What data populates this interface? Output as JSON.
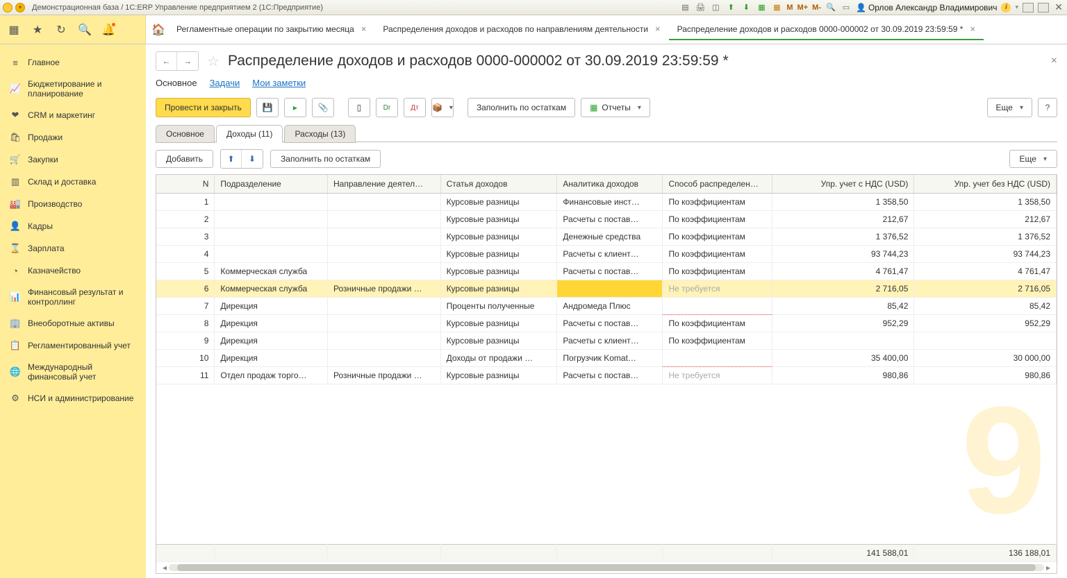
{
  "titlebar": {
    "text": "Демонстрационная база / 1С:ERP Управление предприятием 2  (1С:Предприятие)",
    "user": "Орлов Александр Владимирович",
    "m_labels": [
      "M",
      "M+",
      "M-"
    ]
  },
  "tabs": [
    {
      "label": "Регламентные операции по закрытию месяца",
      "active": false
    },
    {
      "label": "Распределения доходов и расходов по направлениям деятельности",
      "active": false
    },
    {
      "label": "Распределение доходов и расходов  0000-000002 от 30.09.2019 23:59:59 *",
      "active": true
    }
  ],
  "sidebar": [
    {
      "icon": "≡",
      "label": "Главное"
    },
    {
      "icon": "📈",
      "label": "Бюджетирование и планирование"
    },
    {
      "icon": "❤",
      "label": "CRM и маркетинг"
    },
    {
      "icon": "🛍",
      "label": "Продажи"
    },
    {
      "icon": "🛒",
      "label": "Закупки"
    },
    {
      "icon": "▥",
      "label": "Склад и доставка"
    },
    {
      "icon": "🏭",
      "label": "Производство"
    },
    {
      "icon": "👤",
      "label": "Кадры"
    },
    {
      "icon": "⌛",
      "label": "Зарплата"
    },
    {
      "icon": "◔",
      "label": "Казначейство"
    },
    {
      "icon": "📊",
      "label": "Финансовый результат и контроллинг"
    },
    {
      "icon": "🏢",
      "label": "Внеоборотные активы"
    },
    {
      "icon": "📋",
      "label": "Регламентированный учет"
    },
    {
      "icon": "🌐",
      "label": "Международный финансовый учет"
    },
    {
      "icon": "⚙",
      "label": "НСИ и администрирование"
    }
  ],
  "page": {
    "title": "Распределение доходов и расходов  0000-000002 от 30.09.2019 23:59:59 *",
    "subnav": {
      "main": "Основное",
      "tasks": "Задачи",
      "notes": "Мои заметки"
    },
    "buttons": {
      "post_close": "Провести и закрыть",
      "fill_balances": "Заполнить по остаткам",
      "reports": "Отчеты",
      "more": "Еще"
    },
    "section_tabs": {
      "main": "Основное",
      "income": "Доходы (11)",
      "expense": "Расходы (13)"
    },
    "row_buttons": {
      "add": "Добавить",
      "fill": "Заполнить по остаткам",
      "more": "Еще"
    }
  },
  "table": {
    "columns": [
      "N",
      "Подразделение",
      "Направление деятел…",
      "Статья доходов",
      "Аналитика доходов",
      "Способ распределен…",
      "Упр. учет с НДС (USD)",
      "Упр. учет без НДС (USD)"
    ],
    "rows": [
      {
        "n": "1",
        "dept": "",
        "dir": "",
        "item": "Курсовые разницы",
        "an": "Финансовые инст…",
        "mode": "По коэффициентам",
        "v1": "1 358,50",
        "v2": "1 358,50"
      },
      {
        "n": "2",
        "dept": "",
        "dir": "",
        "item": "Курсовые разницы",
        "an": "Расчеты с постав…",
        "mode": "По коэффициентам",
        "v1": "212,67",
        "v2": "212,67"
      },
      {
        "n": "3",
        "dept": "",
        "dir": "",
        "item": "Курсовые разницы",
        "an": "Денежные средства",
        "mode": "По коэффициентам",
        "v1": "1 376,52",
        "v2": "1 376,52"
      },
      {
        "n": "4",
        "dept": "",
        "dir": "",
        "item": "Курсовые разницы",
        "an": "Расчеты с клиент…",
        "mode": "По коэффициентам",
        "v1": "93 744,23",
        "v2": "93 744,23"
      },
      {
        "n": "5",
        "dept": "Коммерческая служба",
        "dir": "",
        "item": "Курсовые разницы",
        "an": "Расчеты с постав…",
        "mode": "По коэффициентам",
        "v1": "4 761,47",
        "v2": "4 761,47"
      },
      {
        "n": "6",
        "dept": "Коммерческая служба",
        "dir": "Розничные продажи …",
        "item": "Курсовые разницы",
        "an": "",
        "mode": "Не требуется",
        "v1": "2 716,05",
        "v2": "2 716,05",
        "selected": true
      },
      {
        "n": "7",
        "dept": "Дирекция",
        "dir": "",
        "item": "Проценты полученные",
        "an": "Андромеда Плюс",
        "mode": "",
        "v1": "85,42",
        "v2": "85,42",
        "red": true
      },
      {
        "n": "8",
        "dept": "Дирекция",
        "dir": "",
        "item": "Курсовые разницы",
        "an": "Расчеты с постав…",
        "mode": "По коэффициентам",
        "v1": "952,29",
        "v2": "952,29"
      },
      {
        "n": "9",
        "dept": "Дирекция",
        "dir": "",
        "item": "Курсовые разницы",
        "an": "Расчеты с клиент…",
        "mode": "По коэффициентам",
        "v1": "",
        "v2": ""
      },
      {
        "n": "10",
        "dept": "Дирекция",
        "dir": "",
        "item": "Доходы от продажи …",
        "an": "Погрузчик Komat…",
        "mode": "",
        "v1": "35 400,00",
        "v2": "30 000,00",
        "red": true
      },
      {
        "n": "11",
        "dept": "Отдел продаж торго…",
        "dir": "Розничные продажи …",
        "item": "Курсовые разницы",
        "an": "Расчеты с постав…",
        "mode": "Не требуется",
        "v1": "980,86",
        "v2": "980,86",
        "muted": true
      }
    ],
    "totals": {
      "v1": "141 588,01",
      "v2": "136 188,01"
    }
  }
}
